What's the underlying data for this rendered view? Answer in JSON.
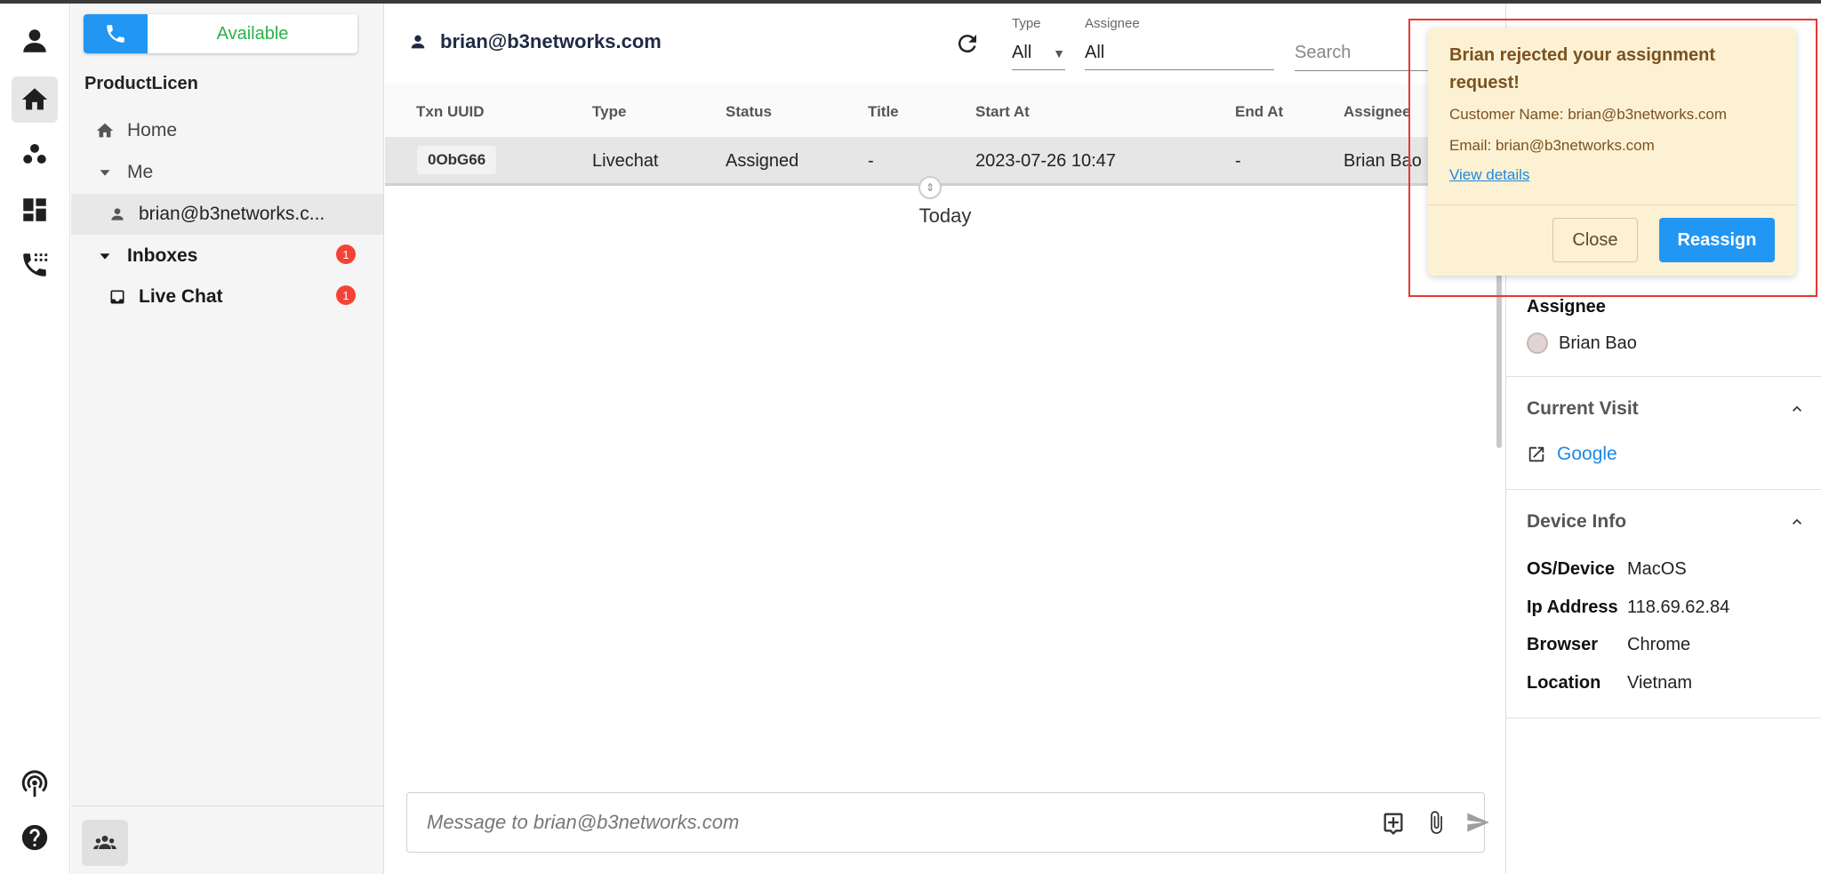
{
  "status": {
    "label": "Available"
  },
  "sidebar": {
    "org_name": "ProductLicen",
    "home": "Home",
    "me": "Me",
    "me_user": "brian@b3networks.c...",
    "inboxes": "Inboxes",
    "inboxes_badge": "1",
    "live_chat": "Live Chat",
    "live_chat_badge": "1"
  },
  "header": {
    "conversation_title": "brian@b3networks.com",
    "type_label": "Type",
    "type_value": "All",
    "assignee_label": "Assignee",
    "assignee_value": "All",
    "search_placeholder": "Search"
  },
  "table": {
    "columns": [
      "Txn UUID",
      "Type",
      "Status",
      "Title",
      "Start At",
      "End At",
      "Assignee"
    ],
    "row": {
      "txn_uuid": "0ObG66",
      "type": "Livechat",
      "status": "Assigned",
      "title": "-",
      "start_at": "2023-07-26 10:47",
      "end_at": "-",
      "assignee": "Brian Bao"
    }
  },
  "timeline": {
    "day_label": "Today"
  },
  "composer": {
    "placeholder": "Message to brian@b3networks.com"
  },
  "right_panel": {
    "assignee_title": "Assignee",
    "assignee_name": "Brian Bao",
    "current_visit_title": "Current Visit",
    "visit_link": "Google",
    "device_info_title": "Device Info",
    "device": [
      {
        "key": "OS/Device",
        "value": "MacOS"
      },
      {
        "key": "Ip Address",
        "value": "118.69.62.84"
      },
      {
        "key": "Browser",
        "value": "Chrome"
      },
      {
        "key": "Location",
        "value": "Vietnam"
      }
    ]
  },
  "toast": {
    "title": "Brian rejected your assignment request!",
    "customer_name": "Customer Name: brian@b3networks.com",
    "email": "Email: brian@b3networks.com",
    "view_details": "View details",
    "close": "Close",
    "reassign": "Reassign"
  },
  "colors": {
    "primary": "#2196f3",
    "available": "#2bb24c",
    "badge": "#f44336",
    "toast_bg": "#fdf1d3",
    "highlight_frame": "#e53935"
  },
  "icons": [
    "user-icon",
    "home-icon",
    "contacts-icon",
    "dashboard-icon",
    "phone-log-icon",
    "broadcast-icon",
    "help-icon",
    "phone-icon",
    "person-icon",
    "inbox-icon",
    "refresh-icon",
    "dropdown-icon",
    "note-add-icon",
    "attach-icon",
    "send-icon",
    "external-link-icon",
    "chevron-up-icon",
    "team-icon"
  ]
}
